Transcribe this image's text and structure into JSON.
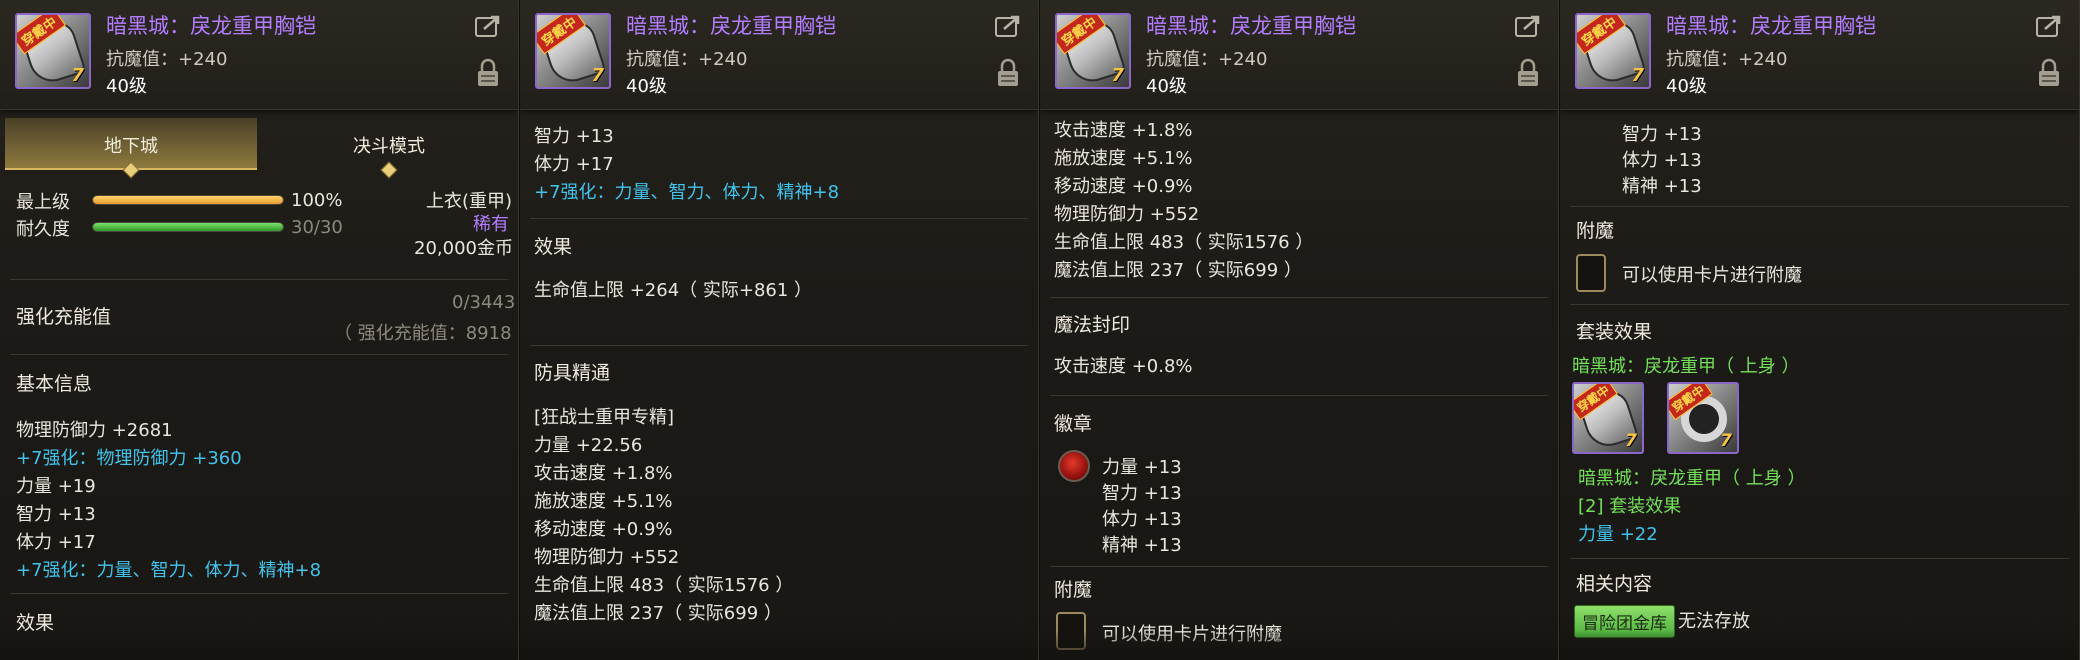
{
  "item": {
    "name": "暗黑城：戾龙重甲胸铠",
    "resistance": "抗魔值：+240",
    "level": "40级",
    "badge": "穿戴中",
    "upgrade": "7"
  },
  "icons": {
    "share": "share-icon",
    "lock": "lock-icon",
    "emblem": "red-emblem-icon",
    "enchant_slot": "card-slot-icon"
  },
  "colors": {
    "item_name": "#b47cff",
    "reinforce": "#41c3ec",
    "set_green": "#74e05a",
    "durability_bar": "#4caf3b",
    "grade_bar": "#e99b2e"
  },
  "panel1": {
    "tabs": [
      "地下城",
      "决斗模式"
    ],
    "grade_label": "最上级",
    "grade_value": "100%",
    "grade_fraction": 1.0,
    "durability_label": "耐久度",
    "durability_value": "30/30",
    "durability_fraction": 1.0,
    "slot_type": "上衣(重甲)",
    "rarity": "稀有",
    "price": "20,000金币",
    "charge_label": "强化充能值",
    "charge_value": "0/3443",
    "charge_sub": "（ 强化充能值：8918 ）",
    "basic_info_title": "基本信息",
    "stats": [
      "物理防御力 +2681",
      "+7强化：物理防御力 +360",
      "力量 +19",
      "智力 +13",
      "体力 +17",
      "+7强化：力量、智力、体力、精神+8"
    ],
    "effect_title": "效果"
  },
  "panel2": {
    "top_lines": [
      "智力 +13",
      "体力 +17",
      "+7强化：力量、智力、体力、精神+8"
    ],
    "effect_title": "效果",
    "effect_line": "生命值上限 +264（ 实际+861 ）",
    "mastery_title": "防具精通",
    "mastery_lines": [
      "[狂战士重甲专精]",
      "力量 +22.56",
      "攻击速度 +1.8%",
      "施放速度 +5.1%",
      "移动速度 +0.9%",
      "物理防御力 +552",
      "生命值上限 483（ 实际1576 ）",
      "魔法值上限 237（ 实际699 ）"
    ]
  },
  "panel3": {
    "top_lines": [
      "攻击速度 +1.8%",
      "施放速度 +5.1%",
      "移动速度 +0.9%",
      "物理防御力 +552",
      "生命值上限 483（ 实际1576 ）",
      "魔法值上限 237（ 实际699 ）"
    ],
    "seal_title": "魔法封印",
    "seal_line": "攻击速度 +0.8%",
    "emblem_title": "徽章",
    "emblem_lines": [
      "力量 +13",
      "智力 +13",
      "体力 +13",
      "精神 +13"
    ],
    "enchant_title": "附魔",
    "enchant_line": "可以使用卡片进行附魔"
  },
  "panel4": {
    "top_lines": [
      "智力 +13",
      "体力 +13",
      "精神 +13"
    ],
    "enchant_title": "附魔",
    "enchant_line": "可以使用卡片进行附魔",
    "set_title": "套装效果",
    "set_name": "暗黑城：戾龙重甲（ 上身 ）",
    "set_item_line": "暗黑城：戾龙重甲（ 上身 ）",
    "set_effect_line": "[2] 套装效果",
    "set_bonus": "力量 +22",
    "related_title": "相关内容",
    "related_tag": "冒险团金库",
    "related_value": "无法存放"
  }
}
